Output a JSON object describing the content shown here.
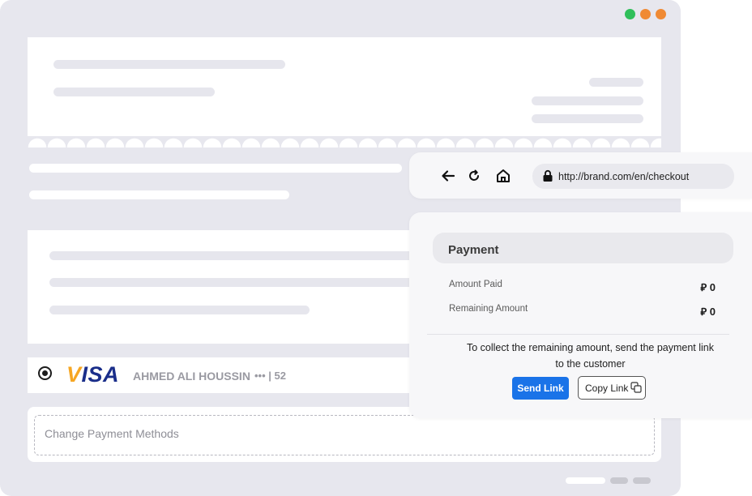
{
  "window": {
    "controls": [
      {
        "name": "green",
        "color": "#2fbf5a"
      },
      {
        "name": "orange",
        "color": "#f08a34"
      },
      {
        "name": "orange2",
        "color": "#f08a34"
      }
    ]
  },
  "saved_card": {
    "brand": "VISA",
    "holder": "AHMED ALI HOUSSIN",
    "masked_number": "••• | 52",
    "selected": true
  },
  "change_payment": {
    "label": "Change Payment Methods"
  },
  "browser": {
    "back_icon": "arrow-left-icon",
    "reload_icon": "reload-icon",
    "home_icon": "home-icon",
    "lock_icon": "lock-icon",
    "url": "http://brand.com/en/checkout"
  },
  "payment": {
    "title": "Payment",
    "rows": [
      {
        "label": "Amount Paid",
        "currency": "⃁",
        "value": "0"
      },
      {
        "label": "Remaining Amount",
        "currency": "⃁",
        "value": "0"
      }
    ],
    "message": "To collect the remaining amount, send the payment link to the customer",
    "send_label": "Send Link",
    "copy_label": "Copy Link",
    "accent": "#1a73e8"
  }
}
